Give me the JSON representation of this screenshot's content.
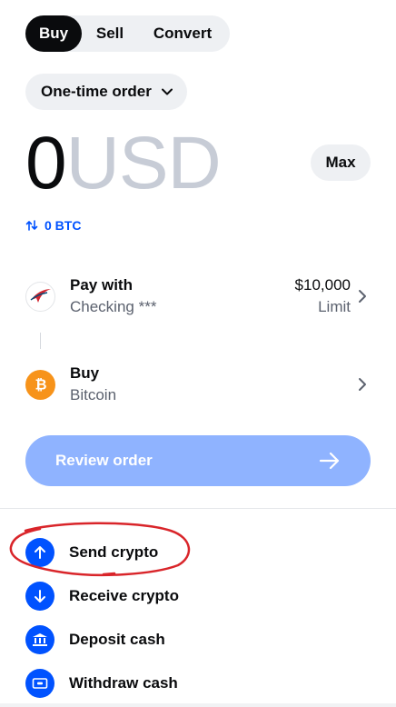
{
  "tabs": [
    {
      "label": "Buy",
      "active": true
    },
    {
      "label": "Sell",
      "active": false
    },
    {
      "label": "Convert",
      "active": false
    }
  ],
  "order_type": {
    "label": "One-time order",
    "icon": "chevron-down-icon"
  },
  "amount": {
    "value": "0",
    "currency": "USD"
  },
  "max_label": "Max",
  "conversion": {
    "icon": "swap-icon",
    "label": "0 BTC"
  },
  "pay_with": {
    "title": "Pay with",
    "subtitle": "Checking ***",
    "limit_value": "$10,000",
    "limit_label": "Limit",
    "icon": "bank-logo-icon"
  },
  "buy_asset": {
    "title": "Buy",
    "subtitle": "Bitcoin",
    "icon": "bitcoin-icon",
    "icon_color": "#f7931a"
  },
  "review_button": {
    "label": "Review order",
    "icon": "arrow-right-icon"
  },
  "actions": [
    {
      "label": "Send crypto",
      "icon": "arrow-up-icon"
    },
    {
      "label": "Receive crypto",
      "icon": "arrow-down-icon"
    },
    {
      "label": "Deposit cash",
      "icon": "bank-icon"
    },
    {
      "label": "Withdraw cash",
      "icon": "cash-icon"
    }
  ],
  "colors": {
    "accent": "#0052ff",
    "review_disabled": "#8fb3ff",
    "annotation": "#d9252a"
  }
}
